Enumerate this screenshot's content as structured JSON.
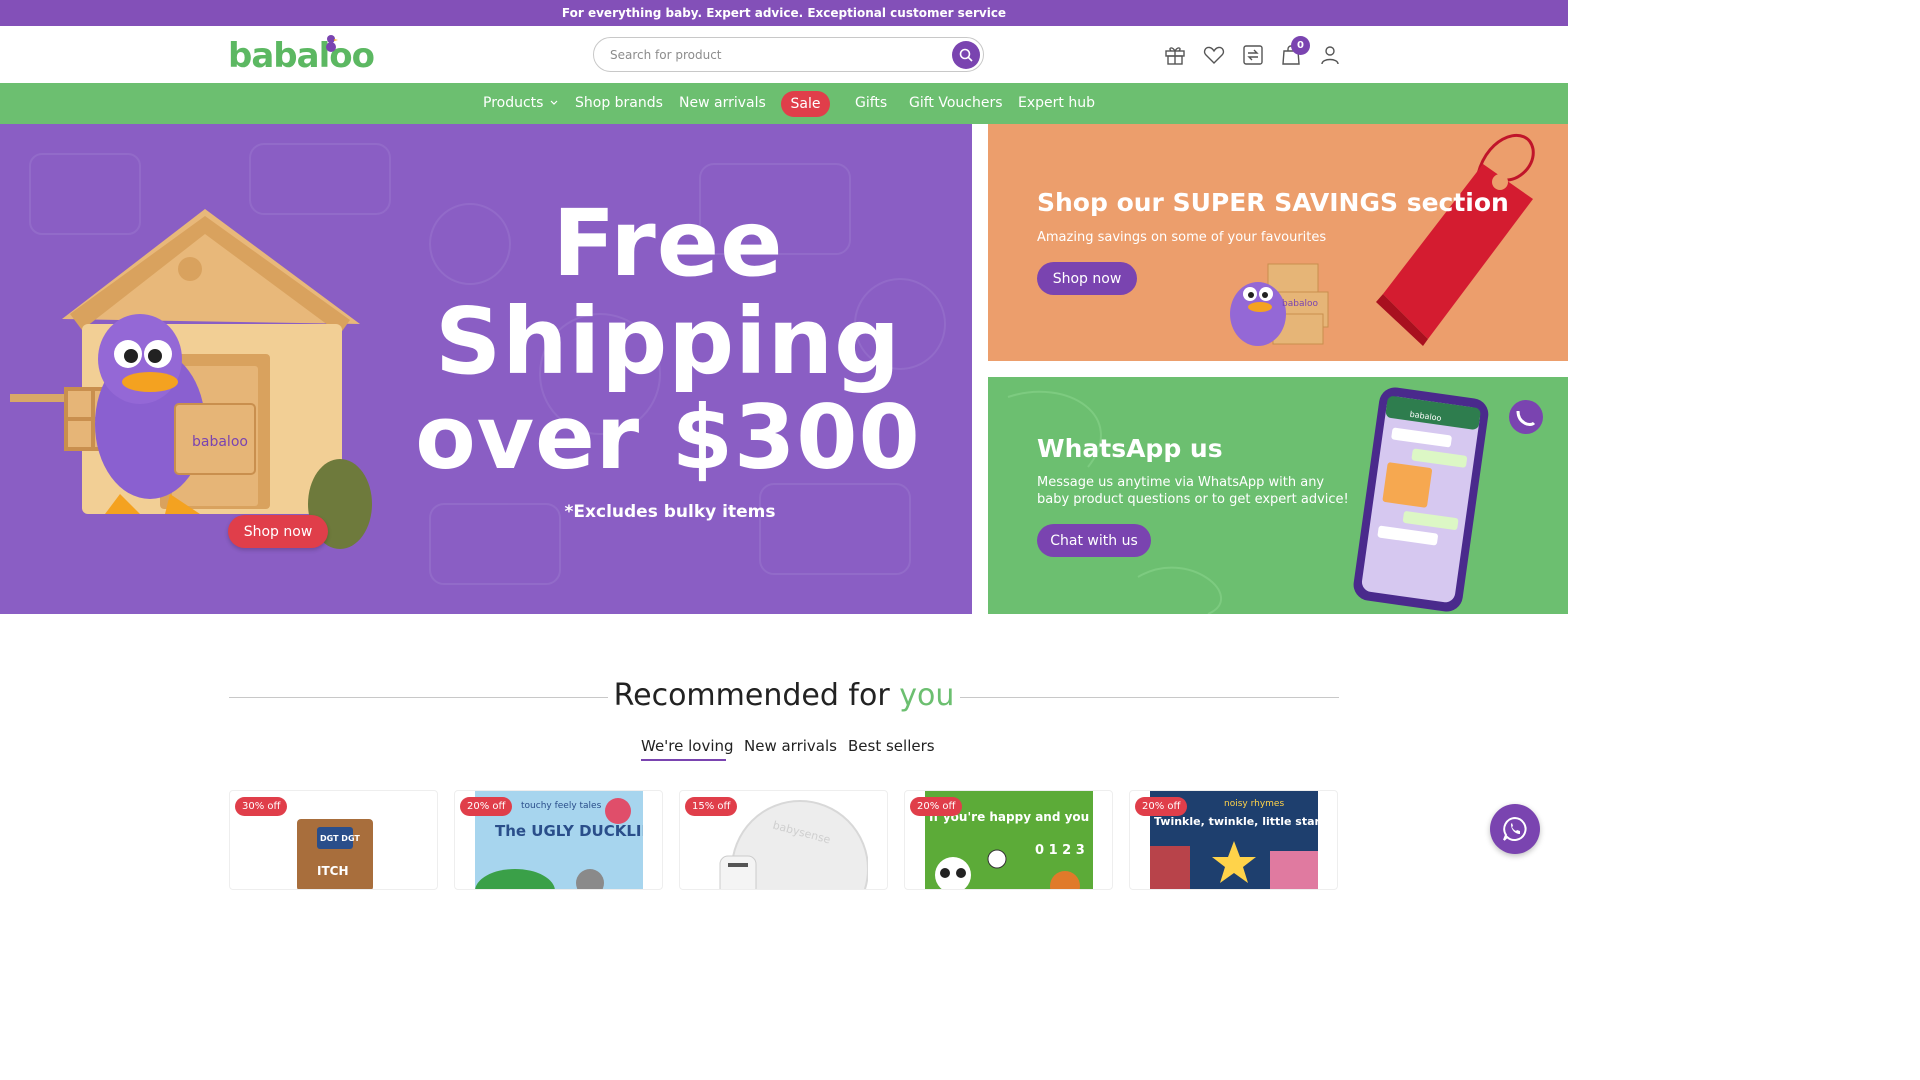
{
  "announcement": "For everything baby. Expert advice. Exceptional customer service",
  "brand": {
    "logo_text": "babaloo",
    "primary": "#7a44b0",
    "green": "#6cbf70",
    "sale_red": "#e03e4a",
    "top_purple": "#8350b8"
  },
  "search": {
    "placeholder": "Search for product",
    "value": ""
  },
  "header_icons": [
    "gift-icon",
    "heart-icon",
    "compare-icon",
    "bag-icon",
    "user-icon"
  ],
  "cart": {
    "count": "0"
  },
  "nav": {
    "products": "Products",
    "shop_brands": "Shop brands",
    "new_arrivals": "New arrivals",
    "sale": "Sale",
    "gifts": "Gifts",
    "gift_vouchers": "Gift Vouchers",
    "expert_hub": "Expert hub"
  },
  "hero": {
    "line1": "Free",
    "line2": "Shipping",
    "line3": "over $300",
    "note": "*Excludes bulky items",
    "box_label": "babaloo",
    "button": "Shop now"
  },
  "promo_savings": {
    "title": "Shop our SUPER SAVINGS section",
    "subtitle": "Amazing savings on some of your favourites",
    "button": "Shop now",
    "box_label": "babaloo"
  },
  "promo_whatsapp": {
    "title": "WhatsApp us",
    "subtitle": "Message us anytime via WhatsApp with any baby product questions or to get expert advice!",
    "button": "Chat with us",
    "phone_header": "babaloo"
  },
  "recommended": {
    "title_main": "Recommended for",
    "title_accent": "you",
    "tabs": [
      "We're loving",
      "New arrivals",
      "Best sellers"
    ],
    "active_tab": "We're loving"
  },
  "products": [
    {
      "badge": "30% off",
      "art_text": "ITCH",
      "art_text2": "DGT DGT"
    },
    {
      "badge": "20% off",
      "art_text": "The UGLY DUCKLING",
      "art_text2": "touchy feely tales"
    },
    {
      "badge": "15% off",
      "art_text": "babysense"
    },
    {
      "badge": "20% off",
      "art_text": "If you're happy and you know it",
      "art_text2": "0 1 2 3"
    },
    {
      "badge": "20% off",
      "art_text": "Twinkle, twinkle, little star",
      "art_text2": "noisy rhymes"
    }
  ]
}
